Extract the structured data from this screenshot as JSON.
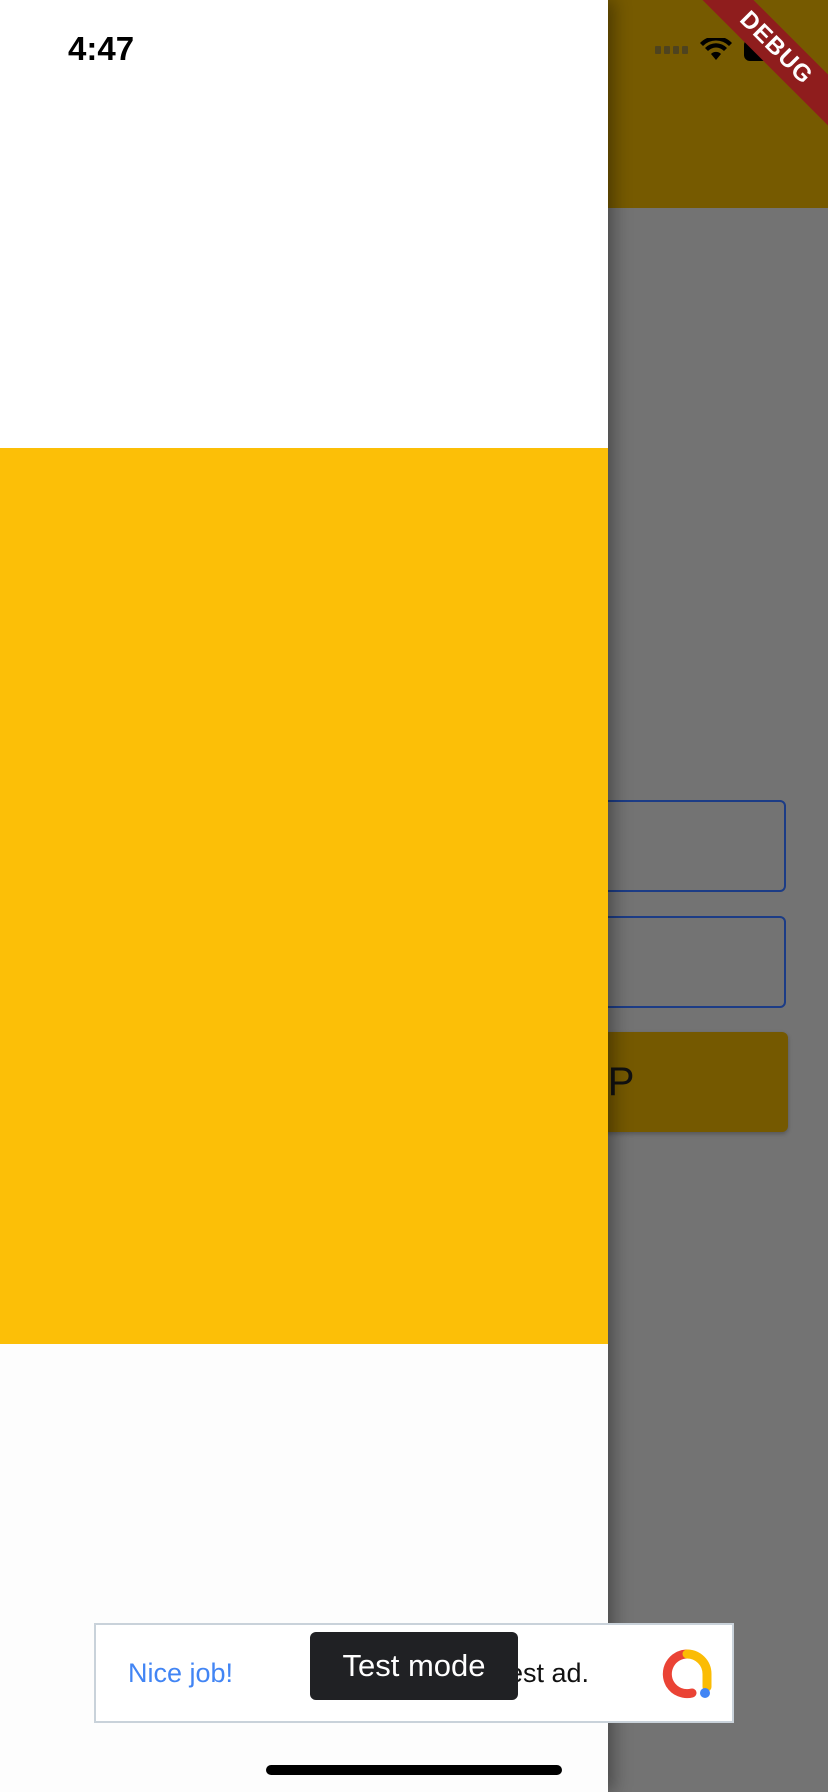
{
  "status_bar": {
    "time": "4:47"
  },
  "debug_banner": {
    "label": "DEBUG"
  },
  "signup_form": {
    "button_label": "SIGNUP"
  },
  "ad": {
    "headline": "Nice job!",
    "body": "This is a test ad.",
    "test_badge": "Test mode"
  },
  "colors": {
    "drawer_header": "#fcbf07",
    "app_bar_dimmed": "#765a00",
    "ad_link": "#4285f4",
    "debug_ribbon": "#8f1d1d"
  }
}
